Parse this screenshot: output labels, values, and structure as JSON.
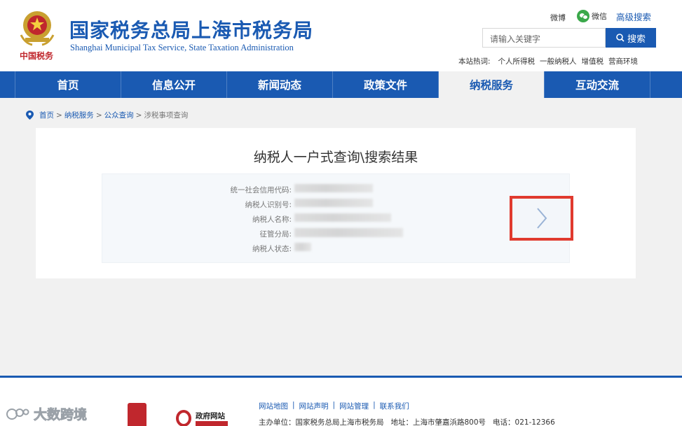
{
  "header": {
    "emblem_caption": "中国税务",
    "title": "国家税务总局上海市税务局",
    "subtitle": "Shanghai Municipal Tax Service, State Taxation Administration",
    "weibo": "微博",
    "wechat": "微信",
    "advanced_search": "高级搜索",
    "search_placeholder": "请输入关键字",
    "search_button": "搜索",
    "hot_label": "本站热词:",
    "hot_words": [
      "个人所得税",
      "一般纳税人",
      "增值税",
      "营商环境"
    ]
  },
  "nav": {
    "items": [
      "首页",
      "信息公开",
      "新闻动态",
      "政策文件",
      "纳税服务",
      "互动交流"
    ],
    "active": "纳税服务"
  },
  "breadcrumb": {
    "items": [
      "首页",
      "纳税服务",
      "公众查询"
    ],
    "current": "涉税事项查询",
    "sep": ">"
  },
  "panel": {
    "title": "纳税人一户式查询\\搜索结果",
    "fields": [
      "统一社会信用代码:",
      "纳税人识别号:",
      "纳税人名称:",
      "征管分局:",
      "纳税人状态:"
    ]
  },
  "footer": {
    "links": [
      "网站地图",
      "网站声明",
      "网站管理",
      "联系我们"
    ],
    "pipe": "|",
    "sponsor": "主办单位：国家税务总局上海市税务局",
    "address": "地址：上海市肇嘉浜路800号",
    "phone": "电话：021-12366",
    "gov_logo_text": "政府网站",
    "watermark": "大数跨境"
  },
  "colors": {
    "brand_blue": "#1a5ab2",
    "highlight_red": "#e03a2e"
  }
}
